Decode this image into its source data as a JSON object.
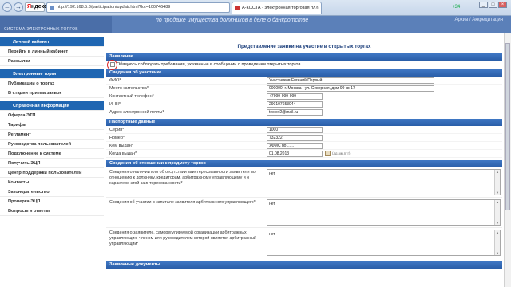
{
  "browser": {
    "back_icon": "arrow-left",
    "forward_icon": "arrow-right",
    "yandex_label_red": "Я",
    "yandex_label_black": "ндекс",
    "url": "http://192.168.5.3/participation/updatr.html?lot=100746489",
    "tab_title": "А-КОСТА - электронная торговая пл...",
    "tab_close": "×",
    "badge": "+34",
    "win_min": "_",
    "win_max": "□",
    "win_close": "×"
  },
  "header": {
    "logo_subtitle": "СИСТЕМА ЭЛЕКТРОННЫХ ТОРГОВ",
    "slogan": "по продаже имущества должников в деле о банкротстве",
    "right": "Архив / Аккредитация"
  },
  "sidebar": {
    "items": [
      {
        "label": "Личный кабинет",
        "head": true
      },
      {
        "label": "Перейти в личный кабинет"
      },
      {
        "label": "Рассылки"
      },
      {
        "label": "Электронные торги",
        "head": true
      },
      {
        "label": "Публикации о торгах"
      },
      {
        "label": "В стадии приема заявок"
      },
      {
        "label": "Справочная информация",
        "head": true
      },
      {
        "label": "Оферта ЭТП"
      },
      {
        "label": "Тарифы"
      },
      {
        "label": "Регламент"
      },
      {
        "label": "Руководства пользователей"
      },
      {
        "label": "Подключение к системе"
      },
      {
        "label": "Получить ЭЦП"
      },
      {
        "label": "Центр поддержки пользователей"
      },
      {
        "label": "Контакты"
      },
      {
        "label": "Законодательство"
      },
      {
        "label": "Проверка ЭЦП"
      },
      {
        "label": "Вопросы и ответы"
      }
    ]
  },
  "main": {
    "title": "Представление заявки на участие в открытых торгах",
    "sec_application": "Заявление",
    "obligation_text": "Обязуюсь соблюдать требования, указанные в сообщении о проведении открытых торгов",
    "sec_participant": "Сведения об участнике",
    "participant": [
      {
        "label": "ФИО*",
        "value": "Участников Евгений Первый"
      },
      {
        "label": "Место жительства*",
        "value": "000000, г. Москва , ул. Северная, дом 99 кв 17"
      },
      {
        "label": "Контактный телефон*",
        "value": "+7999-999-999"
      },
      {
        "label": "ИНН*",
        "value": "290107653044"
      },
      {
        "label": "Адрес электронной почты*",
        "value": "testov2@mail.ru"
      }
    ],
    "sec_passport": "Паспортные данные",
    "passport": [
      {
        "label": "Серия*",
        "value": "1000"
      },
      {
        "label": "Номер*",
        "value": "732322"
      },
      {
        "label": "Кем выдан*",
        "value": "УФМС по ......"
      },
      {
        "label": "Когда выдан*",
        "value": "01.08.2013",
        "hint": "(дд.мм.гггг)"
      }
    ],
    "sec_relation": "Сведения об отношении к предмету торгов",
    "relation": [
      {
        "label": "Сведения о наличии или об отсутствии заинтересованности заявителя по отношению к должнику, кредиторам, арбитражному управляющему и о характере этой заинтересованности*",
        "value": "нет"
      },
      {
        "label": "Сведения об участии в капитале заявителя арбитражного управляющего*",
        "value": "нет"
      },
      {
        "label": "Сведения о заявителе, саморегулируемой организации арбитражных управляющих, членом или руководителем которой является арбитражный управляющий*",
        "value": "нет"
      }
    ],
    "sec_docs": "Заявочные документы"
  }
}
